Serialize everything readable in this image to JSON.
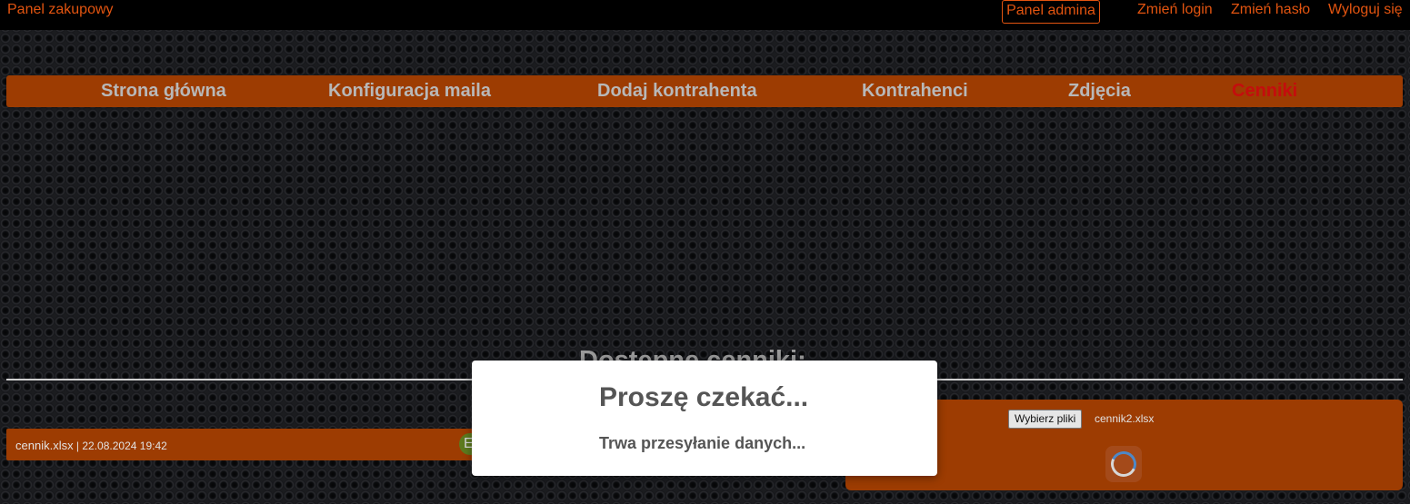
{
  "topbar": {
    "brand": "Panel zakupowy",
    "admin_button": "Panel admina",
    "links": [
      "Zmień login",
      "Zmień hasło",
      "Wyloguj się"
    ]
  },
  "nav": {
    "items": [
      "Strona główna",
      "Konfiguracja maila",
      "Dodaj kontrahenta",
      "Kontrahenci",
      "Zdjęcia",
      "Cenniki"
    ],
    "active": "Cenniki"
  },
  "main": {
    "section_title": "Dostępne cenniki:",
    "files": [
      {
        "name": "cennik.xlsx",
        "separator": " | ",
        "date": "22.08.2024 19:42",
        "badge": "E"
      }
    ]
  },
  "upload": {
    "choose_button": "Wybierz pliki",
    "chosen_file": "cennik2.xlsx"
  },
  "modal": {
    "title": "Proszę czekać...",
    "message": "Trwa przesyłanie danych..."
  },
  "colors": {
    "accent": "#e25410",
    "panel": "#9d3c02",
    "active_nav": "#c40d0d",
    "nav_text": "#b8b8b8"
  }
}
